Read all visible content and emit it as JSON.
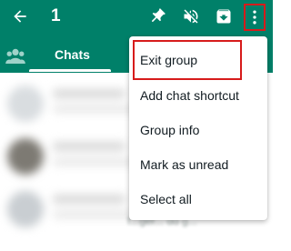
{
  "header": {
    "selected_count": "1",
    "icons": [
      "back-arrow-icon",
      "pin-icon",
      "mute-icon",
      "archive-icon",
      "more-vert-icon"
    ]
  },
  "tabs": {
    "communities_icon": "communities-icon",
    "chats_label": "Chats"
  },
  "menu": {
    "items": [
      {
        "label": "Exit group"
      },
      {
        "label": "Add chat shortcut"
      },
      {
        "label": "Group info"
      },
      {
        "label": "Mark as unread"
      },
      {
        "label": "Select all"
      }
    ]
  },
  "blurred_snippet": "f...ger... dd g...",
  "colors": {
    "brand": "#008069",
    "highlight": "#d71b1b",
    "menu_bg": "#ffffff"
  }
}
